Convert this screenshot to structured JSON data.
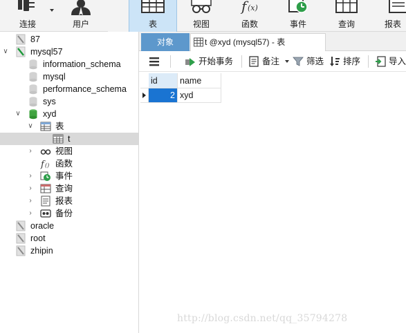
{
  "toolbar": {
    "buttons": [
      {
        "label": "连接",
        "icon": "connection-plug-icon",
        "has_dropdown": true
      },
      {
        "label": "用户",
        "icon": "user-icon"
      },
      {
        "label": "表",
        "icon": "table-icon",
        "active": true
      },
      {
        "label": "视图",
        "icon": "view-glasses-icon"
      },
      {
        "label": "函数",
        "icon": "function-fx-icon"
      },
      {
        "label": "事件",
        "icon": "event-clock-icon"
      },
      {
        "label": "查询",
        "icon": "query-icon"
      },
      {
        "label": "报表",
        "icon": "report-icon"
      }
    ]
  },
  "tree": {
    "items": [
      {
        "label": "87",
        "icon": "connection-icon"
      },
      {
        "label": "mysql57",
        "icon": "connection-active-icon",
        "expanded": true
      },
      {
        "label": "information_schema",
        "icon": "database-icon"
      },
      {
        "label": "mysql",
        "icon": "database-icon"
      },
      {
        "label": "performance_schema",
        "icon": "database-icon"
      },
      {
        "label": "sys",
        "icon": "database-icon"
      },
      {
        "label": "xyd",
        "icon": "database-open-icon",
        "expanded": true
      },
      {
        "label": "表",
        "icon": "tables-folder-icon",
        "expanded": true
      },
      {
        "label": "t",
        "icon": "table-icon",
        "selected": true
      },
      {
        "label": "视图",
        "icon": "views-folder-icon"
      },
      {
        "label": "函数",
        "icon": "functions-folder-icon"
      },
      {
        "label": "事件",
        "icon": "events-folder-icon"
      },
      {
        "label": "查询",
        "icon": "queries-folder-icon"
      },
      {
        "label": "报表",
        "icon": "reports-folder-icon"
      },
      {
        "label": "备份",
        "icon": "backups-folder-icon"
      },
      {
        "label": "oracle",
        "icon": "connection-icon"
      },
      {
        "label": "root",
        "icon": "connection-icon"
      },
      {
        "label": "zhipin",
        "icon": "connection-icon"
      }
    ]
  },
  "tabs": {
    "objects_label": "对象",
    "table_tab_label": "t @xyd (mysql57) - 表"
  },
  "subtoolbar": {
    "begin_transaction": "开始事务",
    "memo": "备注",
    "filter": "筛选",
    "sort": "排序",
    "import": "导入"
  },
  "grid": {
    "columns": [
      "id",
      "name"
    ],
    "rows": [
      {
        "id": "2",
        "name": "xyd"
      }
    ]
  },
  "watermark": "http://blog.csdn.net/qq_35794278",
  "colors": {
    "accent": "#5d98cc",
    "selection": "#1a74d2",
    "active_toolbar": "#cce4f7",
    "tree_selected": "#d9d9d9"
  }
}
